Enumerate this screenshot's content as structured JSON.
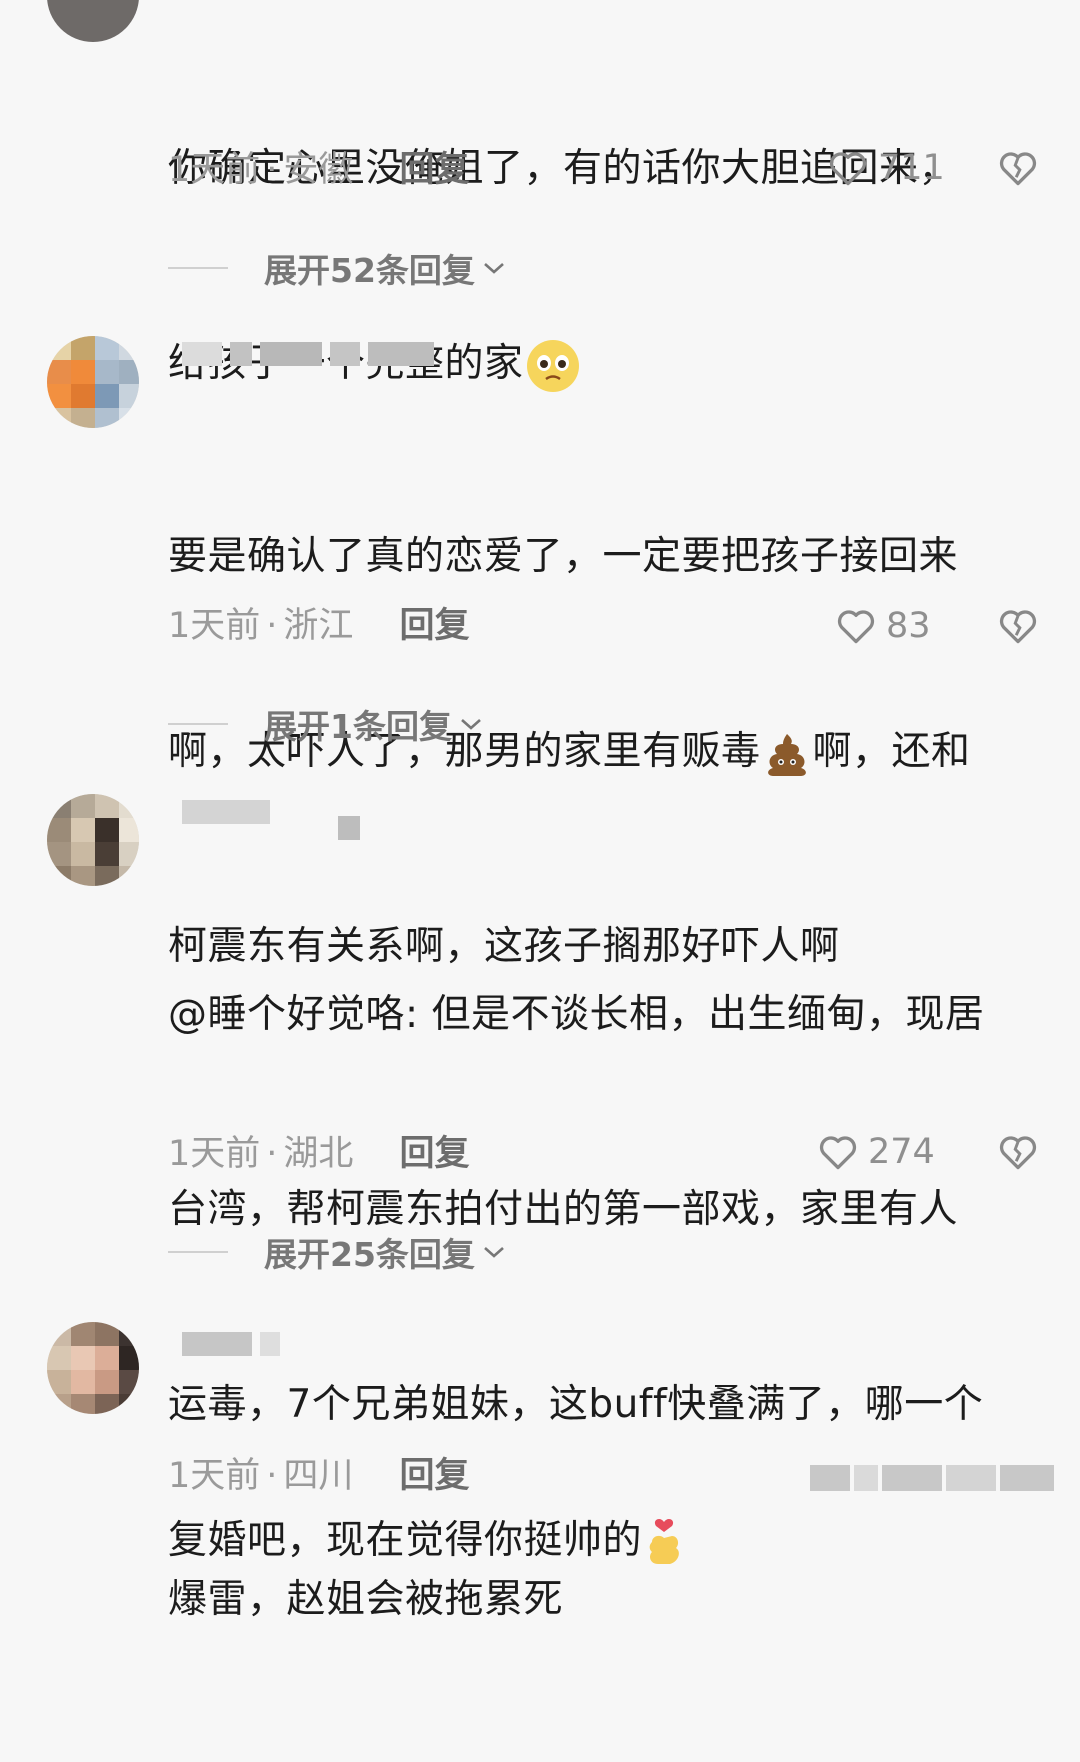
{
  "comments": [
    {
      "text_line1": "你确定心里没俺姐了，有的话你大胆追回来，",
      "text_line2": "给孩子一个完整的家",
      "time": "1天前",
      "location": "安徽",
      "reply_label": "回复",
      "likes": "711",
      "expand_label": "展开52条回复"
    },
    {
      "text_line1": "要是确认了真的恋爱了，一定要把孩子接回来",
      "text_line2a": "啊，太吓人了，那男的家里有贩毒",
      "text_line2b": "啊，还和",
      "text_line3": "柯震东有关系啊，这孩子搁那好吓人啊",
      "time": "1天前",
      "location": "浙江",
      "reply_label": "回复",
      "likes": "83",
      "expand_label": "展开1条回复"
    },
    {
      "text_line1": "@睡个好觉咯: 但是不谈长相，出生缅甸，现居",
      "text_line2": "台湾，帮柯震东拍付出的第一部戏，家里有人",
      "text_line3": "运毒，7个兄弟姐妹，这buff快叠满了，哪一个",
      "text_line4": "爆雷，赵姐会被拖累死",
      "time": "1天前",
      "location": "湖北",
      "reply_label": "回复",
      "likes": "274",
      "expand_label": "展开25条回复"
    },
    {
      "text_line1": "复婚吧，现在觉得你挺帅的",
      "time": "1天前",
      "location": "四川",
      "reply_label": "回复"
    }
  ],
  "separator": "·",
  "icons": {
    "like": "heart-outline-icon",
    "dislike": "broken-heart-icon",
    "expand": "chevron-down-icon"
  },
  "colors": {
    "background": "#f7f7f7",
    "text": "#1c1c1c",
    "meta": "#9a9a9a"
  }
}
